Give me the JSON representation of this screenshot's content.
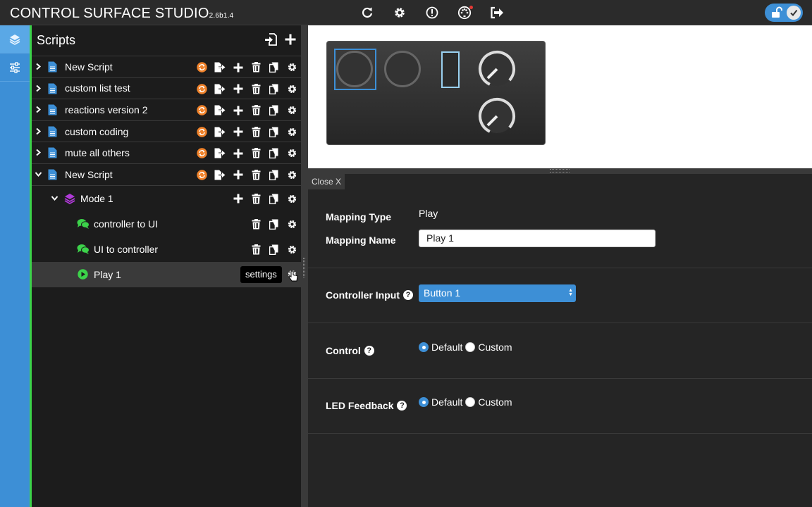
{
  "app": {
    "title": "CONTROL SURFACE STUDIO",
    "version": "2.6b1.4"
  },
  "scripts_panel": {
    "title": "Scripts",
    "scripts": [
      {
        "label": "New Script",
        "expanded": false
      },
      {
        "label": "custom list test",
        "expanded": false
      },
      {
        "label": "reactions version 2",
        "expanded": false
      },
      {
        "label": "custom coding",
        "expanded": false
      },
      {
        "label": "mute all others",
        "expanded": false
      },
      {
        "label": "New Script",
        "expanded": true
      }
    ],
    "mode": {
      "label": "Mode 1"
    },
    "reactions": [
      {
        "label": "controller to UI"
      },
      {
        "label": "UI to controller"
      }
    ],
    "mapping": {
      "label": "Play 1"
    },
    "tooltip": "settings"
  },
  "editor": {
    "close_label": "Close X",
    "mapping_type_label": "Mapping Type",
    "mapping_type_value": "Play",
    "mapping_name_label": "Mapping Name",
    "mapping_name_value": "Play 1",
    "controller_input_label": "Controller Input",
    "controller_input_value": "Button 1",
    "control_label": "Control",
    "led_feedback_label": "LED Feedback",
    "option_default": "Default",
    "option_custom": "Custom",
    "control_selected": "Default",
    "led_selected": "Default",
    "help_glyph": "?"
  },
  "colors": {
    "accent_blue": "#3d8fd6",
    "accent_green": "#3cd24a",
    "sync_orange": "#f0822a",
    "mode_purple": "#b03ad8"
  },
  "icons": {
    "top": [
      "refresh-icon",
      "gear-icon",
      "alert-icon",
      "midi-icon",
      "logout-icon"
    ],
    "row_actions": [
      "sync-icon",
      "export-icon",
      "add-icon",
      "trash-icon",
      "copy-icon",
      "gear-icon"
    ]
  }
}
